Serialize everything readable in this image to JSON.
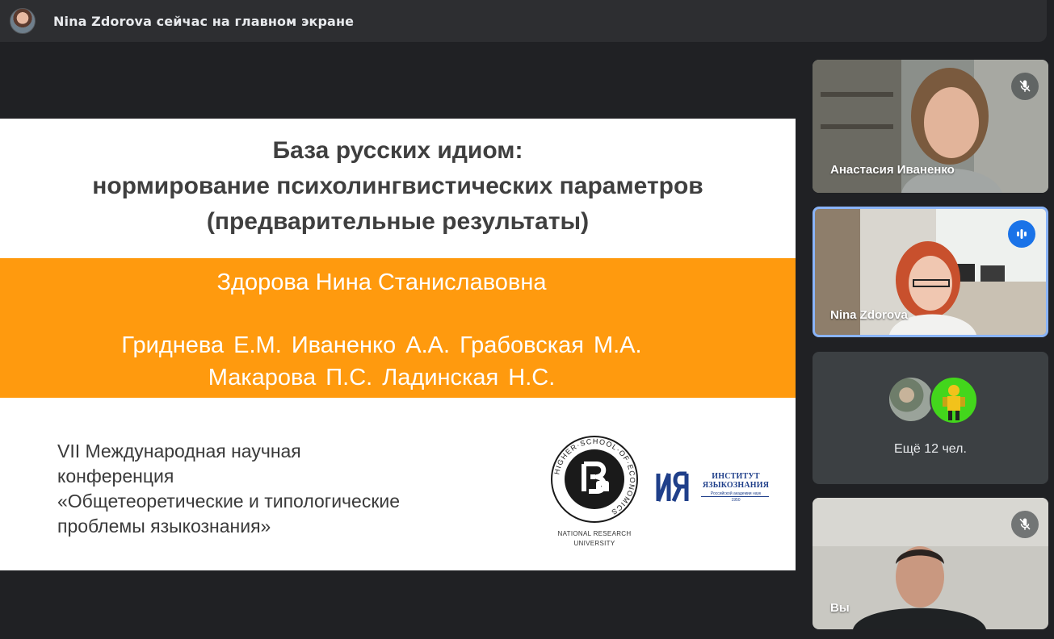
{
  "app": {
    "presenter_banner": "Nina Zdorova сейчас на главном экране"
  },
  "slide": {
    "title_lines": [
      "База русских идиом:",
      "нормирование психолингвистических параметров",
      "(предварительные результаты)"
    ],
    "main_author": "Здорова Нина Станиславовна",
    "coauthors_line1": "Гриднева Е.М.   Иваненко А.А.   Грабовская М.А.",
    "coauthors_line2": "Макарова П.С.   Ладинская Н.С.",
    "conference_lines": [
      "VII  Международная научная",
      "конференция",
      "«Общетеоретические и типологические",
      "проблемы языкознания»"
    ],
    "hse_logo": {
      "ring_text": "HIGHER·SCHOOL·OF·ECONOMICS",
      "caption_line1": "NATIONAL RESEARCH",
      "caption_line2": "UNIVERSITY"
    },
    "iya_logo": {
      "line1": "ИНСТИТУТ",
      "line2": "ЯЗЫКОЗНАНИЯ",
      "sub": "Российской академии наук",
      "year": "1950"
    },
    "accent_color": "#ff9a0e"
  },
  "participants": [
    {
      "name": "Анастасия Иваненко",
      "mic": "muted",
      "icon": "mic-off-icon"
    },
    {
      "name": "Nina Zdorova",
      "mic": "speaking",
      "icon": "audio-level-icon",
      "active": true
    },
    {
      "more_label": "Ещё 12 чел."
    },
    {
      "name": "Вы",
      "mic": "muted",
      "icon": "mic-off-icon"
    }
  ]
}
